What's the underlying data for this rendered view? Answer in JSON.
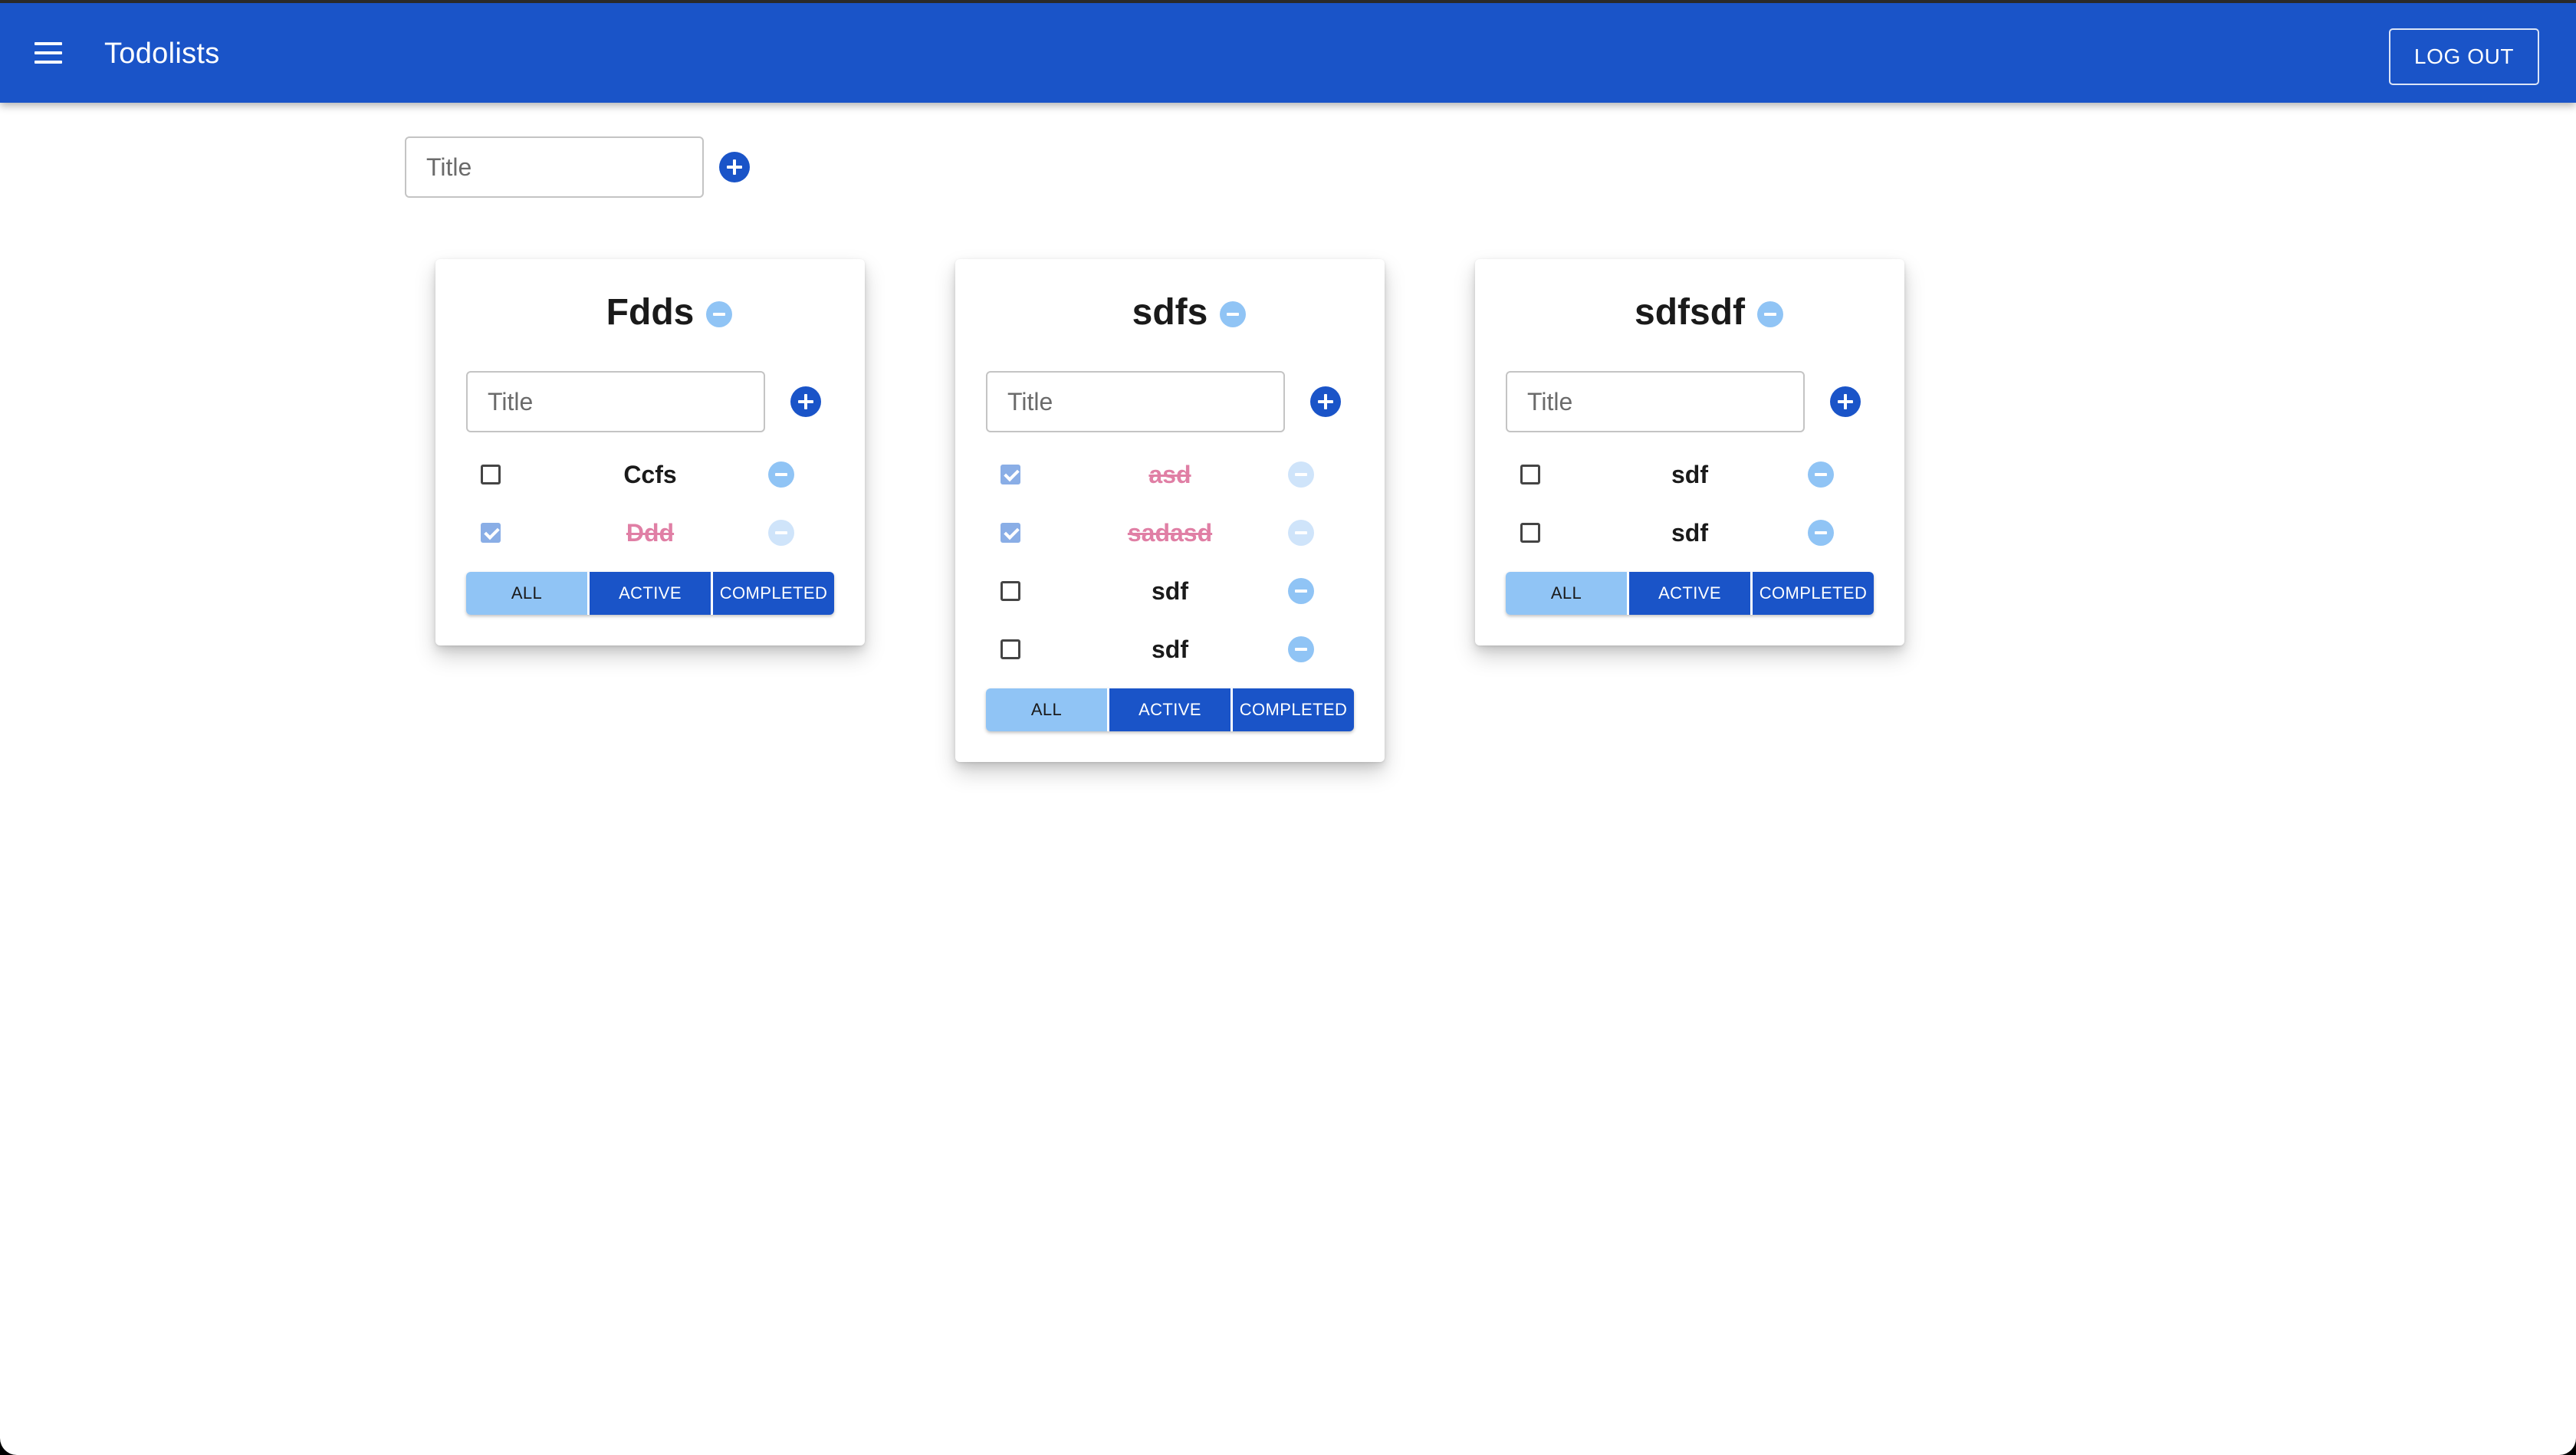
{
  "app": {
    "title": "Todolists",
    "logout_label": "LOG OUT"
  },
  "new_list": {
    "placeholder": "Title"
  },
  "colors": {
    "primary": "#1a54c8",
    "light_primary": "#90c4f5",
    "done_text": "#e07fa5"
  },
  "lists": [
    {
      "title": "Fdds",
      "input_placeholder": "Title",
      "tasks": [
        {
          "title": "Ccfs",
          "done": false
        },
        {
          "title": "Ddd",
          "done": true
        }
      ],
      "filters": [
        "ALL",
        "ACTIVE",
        "COMPLETED"
      ],
      "selected_filter": "ALL"
    },
    {
      "title": "sdfs",
      "input_placeholder": "Title",
      "tasks": [
        {
          "title": "asd",
          "done": true
        },
        {
          "title": "sadasd",
          "done": true
        },
        {
          "title": "sdf",
          "done": false
        },
        {
          "title": "sdf",
          "done": false
        }
      ],
      "filters": [
        "ALL",
        "ACTIVE",
        "COMPLETED"
      ],
      "selected_filter": "ALL"
    },
    {
      "title": "sdfsdf",
      "input_placeholder": "Title",
      "tasks": [
        {
          "title": "sdf",
          "done": false
        },
        {
          "title": "sdf",
          "done": false
        }
      ],
      "filters": [
        "ALL",
        "ACTIVE",
        "COMPLETED"
      ],
      "selected_filter": "ALL"
    }
  ]
}
